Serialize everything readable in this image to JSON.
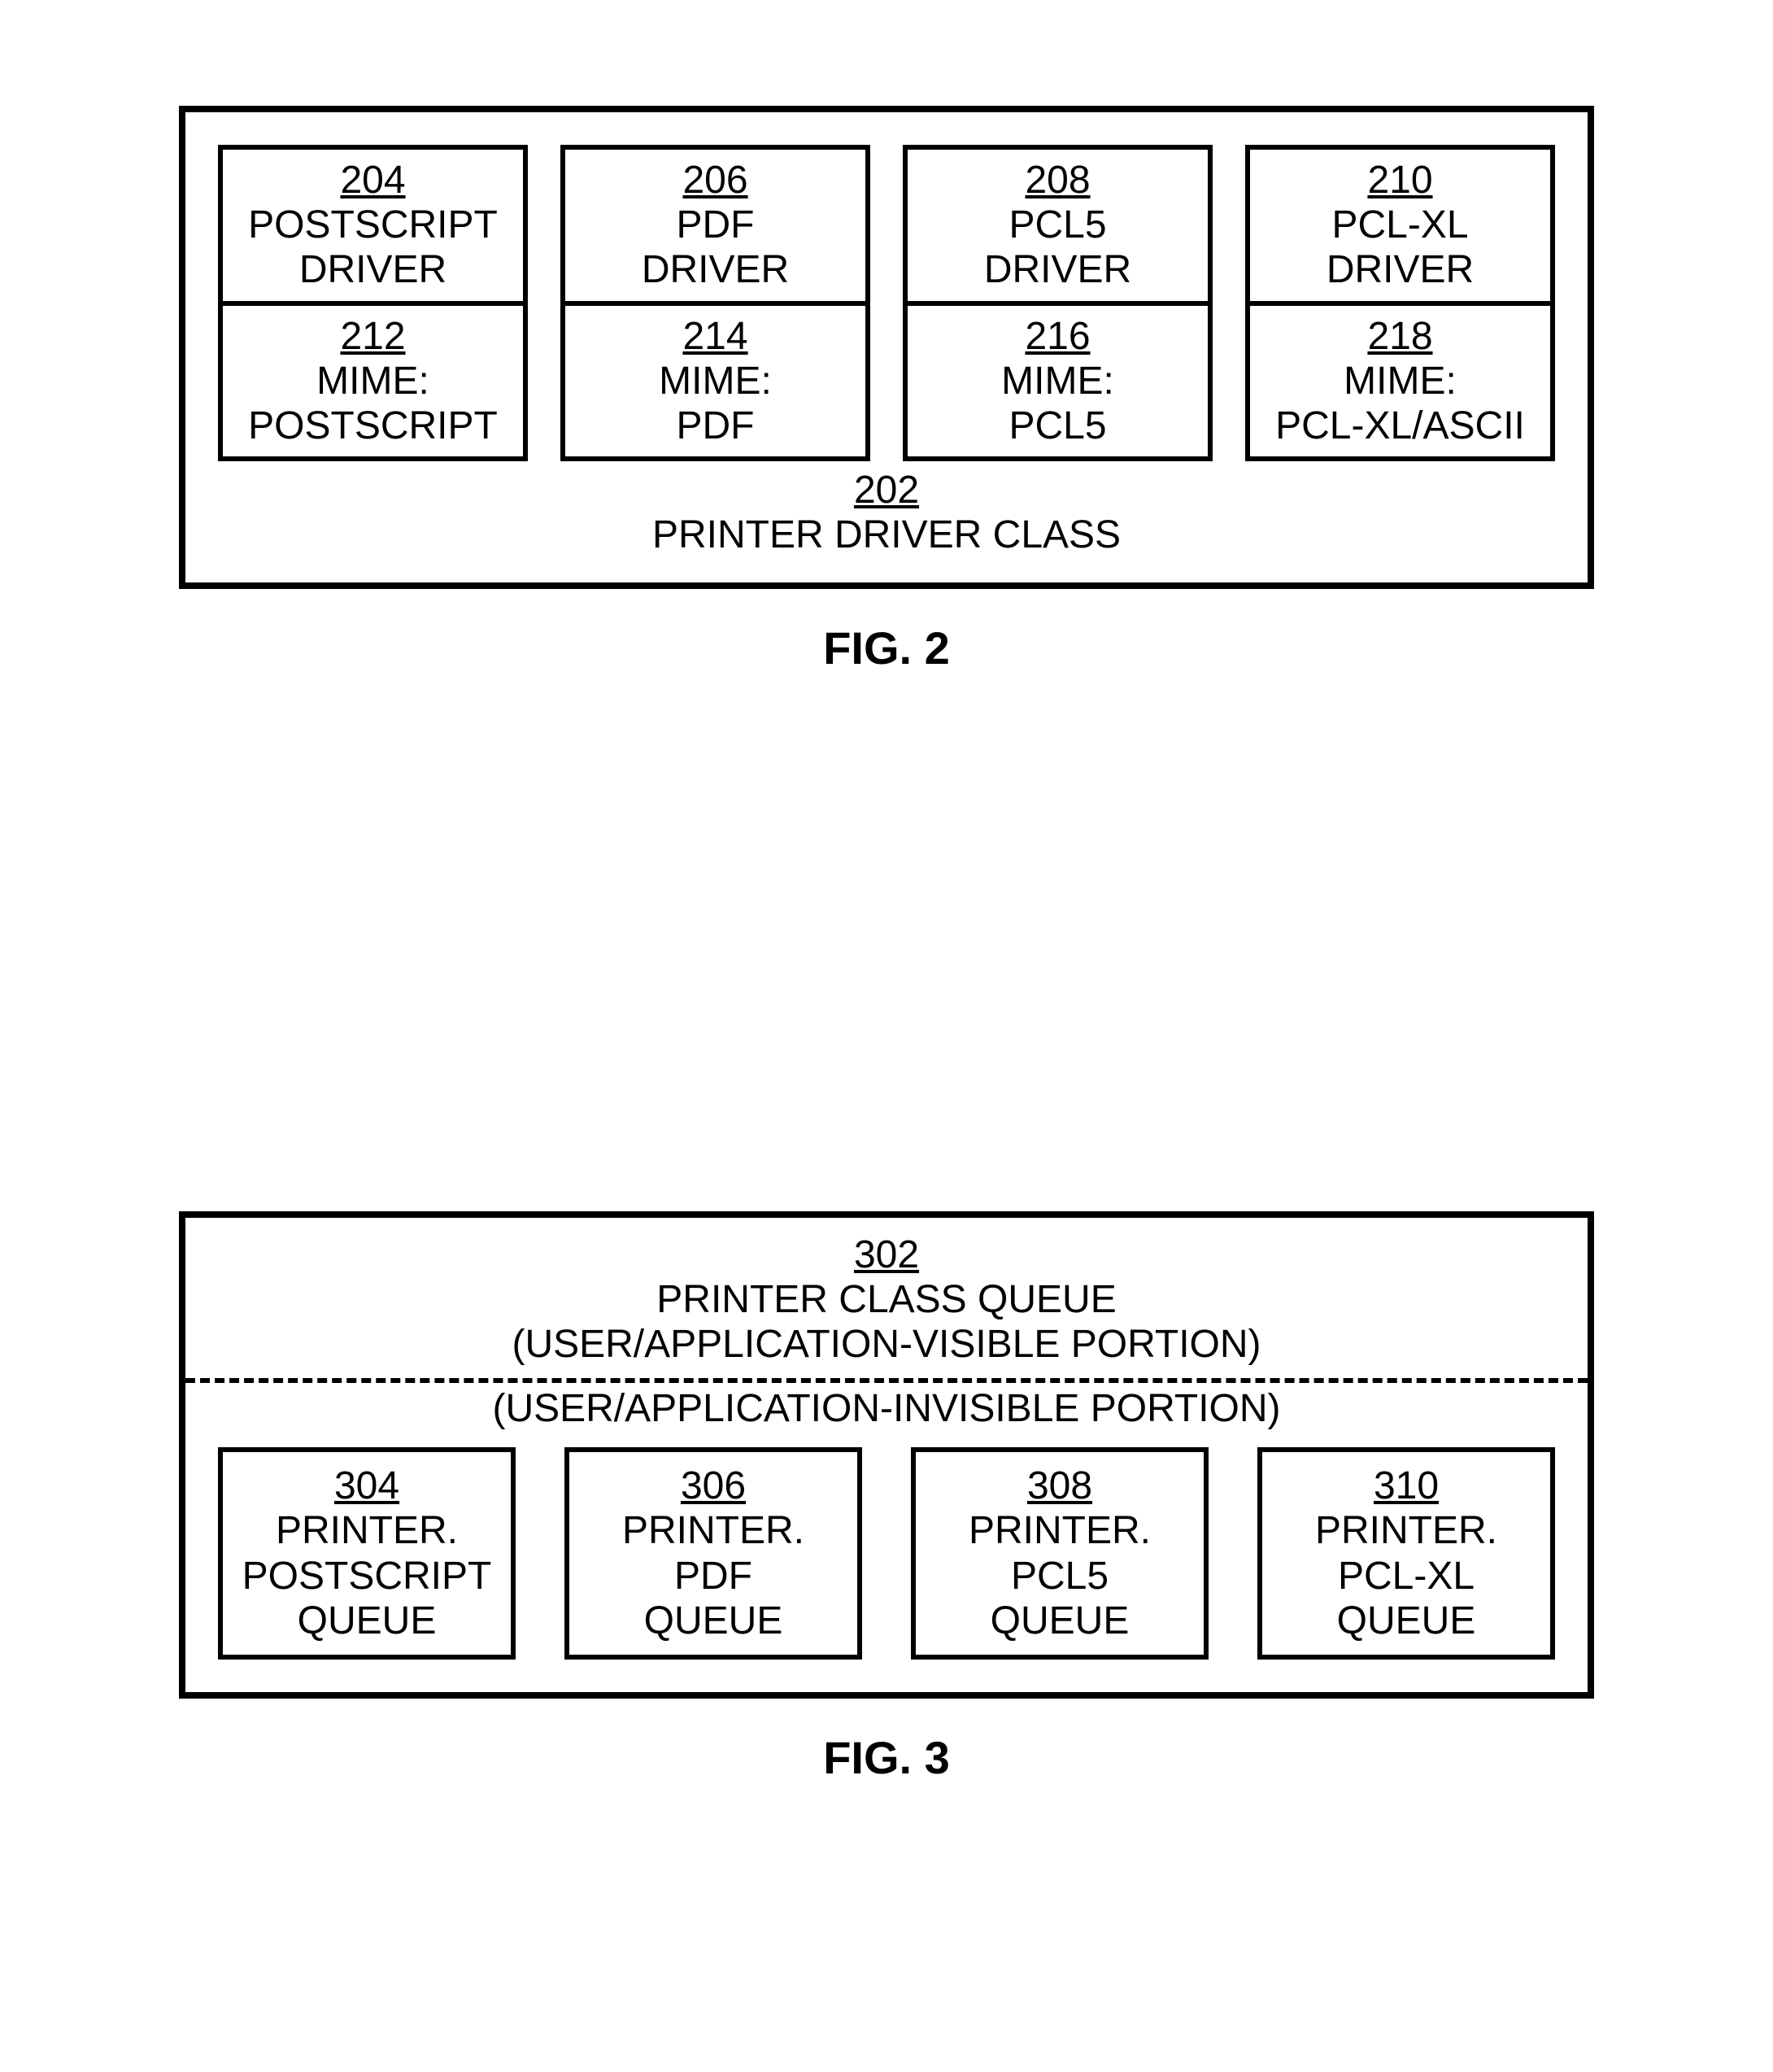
{
  "fig2": {
    "caption": "FIG. 2",
    "container_ref": "202",
    "container_label": "PRINTER DRIVER CLASS",
    "columns": [
      {
        "driver_ref": "204",
        "driver_line1": "POSTSCRIPT",
        "driver_line2": "DRIVER",
        "mime_ref": "212",
        "mime_line1": "MIME:",
        "mime_line2": "POSTSCRIPT"
      },
      {
        "driver_ref": "206",
        "driver_line1": "PDF",
        "driver_line2": "DRIVER",
        "mime_ref": "214",
        "mime_line1": "MIME:",
        "mime_line2": "PDF"
      },
      {
        "driver_ref": "208",
        "driver_line1": "PCL5",
        "driver_line2": "DRIVER",
        "mime_ref": "216",
        "mime_line1": "MIME:",
        "mime_line2": "PCL5"
      },
      {
        "driver_ref": "210",
        "driver_line1": "PCL-XL",
        "driver_line2": "DRIVER",
        "mime_ref": "218",
        "mime_line1": "MIME:",
        "mime_line2": "PCL-XL/ASCII"
      }
    ]
  },
  "fig3": {
    "caption": "FIG. 3",
    "header_ref": "302",
    "header_line1": "PRINTER CLASS QUEUE",
    "header_line2": "(USER/APPLICATION-VISIBLE PORTION)",
    "sublabel": "(USER/APPLICATION-INVISIBLE PORTION)",
    "blocks": [
      {
        "ref": "304",
        "line1": "PRINTER.",
        "line2": "POSTSCRIPT",
        "line3": "QUEUE"
      },
      {
        "ref": "306",
        "line1": "PRINTER.",
        "line2": "PDF",
        "line3": "QUEUE"
      },
      {
        "ref": "308",
        "line1": "PRINTER.",
        "line2": "PCL5",
        "line3": "QUEUE"
      },
      {
        "ref": "310",
        "line1": "PRINTER.",
        "line2": "PCL-XL",
        "line3": "QUEUE"
      }
    ]
  }
}
